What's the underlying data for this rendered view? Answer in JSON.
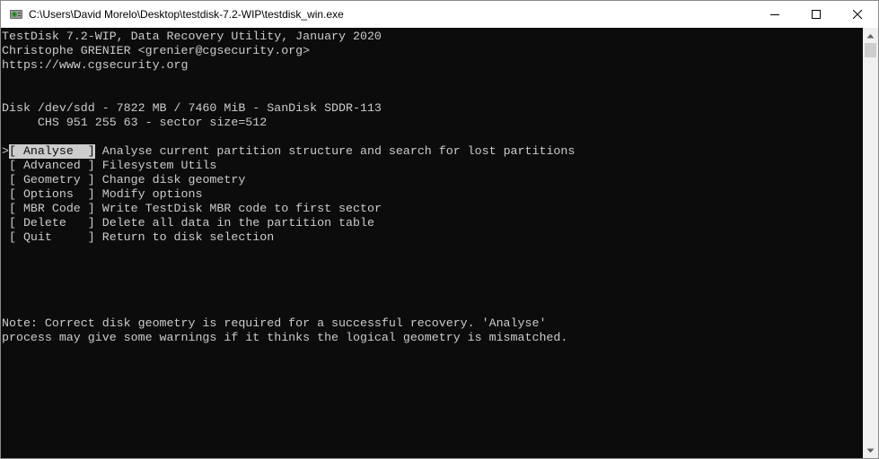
{
  "window": {
    "title": "C:\\Users\\David Morelo\\Desktop\\testdisk-7.2-WIP\\testdisk_win.exe"
  },
  "console": {
    "header": [
      "TestDisk 7.2-WIP, Data Recovery Utility, January 2020",
      "Christophe GRENIER <grenier@cgsecurity.org>",
      "https://www.cgsecurity.org"
    ],
    "disk_line": "Disk /dev/sdd - 7822 MB / 7460 MiB - SanDisk SDDR-113",
    "geometry_line": "     CHS 951 255 63 - sector size=512",
    "cursor": ">",
    "menu": [
      {
        "key": "[ Analyse  ]",
        "desc": " Analyse current partition structure and search for lost partitions",
        "selected": true
      },
      {
        "key": "[ Advanced ]",
        "desc": " Filesystem Utils",
        "selected": false
      },
      {
        "key": "[ Geometry ]",
        "desc": " Change disk geometry",
        "selected": false
      },
      {
        "key": "[ Options  ]",
        "desc": " Modify options",
        "selected": false
      },
      {
        "key": "[ MBR Code ]",
        "desc": " Write TestDisk MBR code to first sector",
        "selected": false
      },
      {
        "key": "[ Delete   ]",
        "desc": " Delete all data in the partition table",
        "selected": false
      },
      {
        "key": "[ Quit     ]",
        "desc": " Return to disk selection",
        "selected": false
      }
    ],
    "note": [
      "Note: Correct disk geometry is required for a successful recovery. 'Analyse'",
      "process may give some warnings if it thinks the logical geometry is mismatched."
    ]
  },
  "colors": {
    "console_bg": "#0c0c0c",
    "console_fg": "#cccccc",
    "selection_bg": "#cccccc"
  }
}
